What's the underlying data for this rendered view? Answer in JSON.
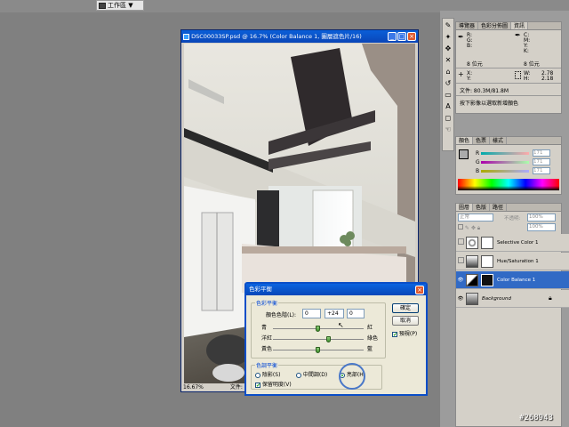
{
  "topbar": {
    "workspace_label": "工作區 ▼"
  },
  "document": {
    "title": "DSC00033SP.psd @ 16.7% (Color Balance 1, 圖層遮色片/16)",
    "zoom": "16.67%",
    "status_label": "文件:"
  },
  "info_panel": {
    "tabs": [
      "導覽器",
      "色彩分佈圖",
      "資訊"
    ],
    "active_tab": "資訊",
    "rgb_labels": [
      "R:",
      "G:",
      "B:"
    ],
    "cmyk_labels": [
      "C:",
      "M:",
      "Y:",
      "K:"
    ],
    "bit_left": "8 位元",
    "bit_right": "8 位元",
    "x_label": "X:",
    "y_label": "Y:",
    "w_label": "W:",
    "h_label": "H:",
    "w_value": "2.78",
    "h_value": "2.18",
    "doc_size": "文件: 80.3M/81.8M",
    "hint": "按下影像以選取新增顏色"
  },
  "color_panel": {
    "tabs": [
      "顏色",
      "色票",
      "樣式"
    ],
    "active_tab": "顏色",
    "channels": [
      {
        "label": "R",
        "value": "171"
      },
      {
        "label": "G",
        "value": "171"
      },
      {
        "label": "B",
        "value": "171"
      }
    ]
  },
  "layers_panel": {
    "tabs": [
      "圖層",
      "色版",
      "路徑"
    ],
    "active_tab": "圖層",
    "blend_mode": "正常",
    "opacity_label": "不透明:",
    "opacity_value": "100%",
    "fill_value": "100%",
    "layers": [
      {
        "name": "Selective Color 1",
        "visible": false,
        "selected": false
      },
      {
        "name": "Hue/Saturation 1",
        "visible": false,
        "selected": false
      },
      {
        "name": "Color Balance 1",
        "visible": true,
        "selected": true
      },
      {
        "name": "Background",
        "visible": true,
        "selected": false
      }
    ]
  },
  "dialog": {
    "title": "色彩平衡",
    "balance_group": "色彩平衡",
    "levels_label": "顏色色階(L):",
    "levels": [
      "0",
      "+24",
      "0"
    ],
    "sliders": [
      {
        "left": "青",
        "right": "紅",
        "value": 0
      },
      {
        "left": "洋紅",
        "right": "綠色",
        "value": 24
      },
      {
        "left": "黃色",
        "right": "藍",
        "value": 0
      }
    ],
    "tone_group": "色調平衡",
    "tones": [
      {
        "label": "陰影(S)",
        "checked": false
      },
      {
        "label": "中間調(D)",
        "checked": false
      },
      {
        "label": "亮部(H)",
        "checked": true
      }
    ],
    "preserve_label": "保留明度(V)",
    "preserve_checked": true,
    "ok_label": "確定",
    "cancel_label": "取消",
    "preview_label": "預視(P)",
    "preview_checked": true
  },
  "watermark": "#268943"
}
